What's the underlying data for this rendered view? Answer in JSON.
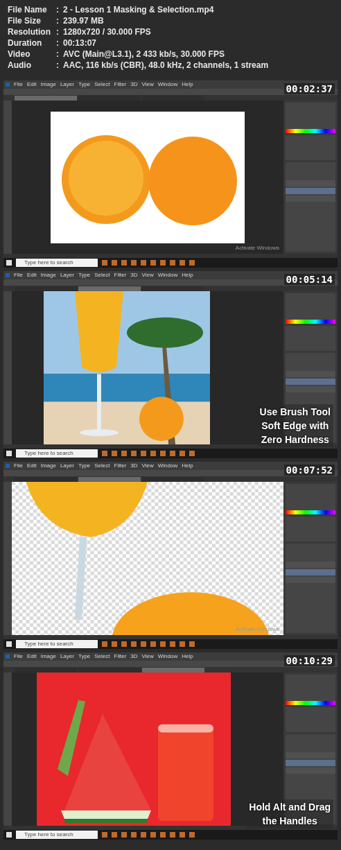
{
  "info": [
    {
      "label": "File Name",
      "separator": ":",
      "value": "2 - Lesson 1 Masking & Selection.mp4"
    },
    {
      "label": "File Size",
      "separator": ":",
      "value": "239.97 MB"
    },
    {
      "label": "Resolution",
      "separator": ":",
      "value": "1280x720 / 30.000 FPS"
    },
    {
      "label": "Duration",
      "separator": ":",
      "value": "00:13:07"
    },
    {
      "label": "Video",
      "separator": ":",
      "value": "AVC (Main@L3.1), 2 433 kb/s, 30.000 FPS"
    },
    {
      "label": "Audio",
      "separator": ":",
      "value": "AAC, 116 kb/s (CBR), 48.0 kHz, 2 channels, 1 stream"
    }
  ],
  "frames": [
    {
      "timestamp": "00:02:37",
      "kind": "oranges",
      "menu": [
        "File",
        "Edit",
        "Image",
        "Layer",
        "Type",
        "Select",
        "Filter",
        "3D",
        "View",
        "Window",
        "Help"
      ],
      "tabs": [
        {
          "selected": true
        },
        {
          "selected": false
        },
        {
          "selected": false
        }
      ],
      "search_placeholder": "Type here to search",
      "activation_notice": "Activate Windows"
    },
    {
      "timestamp": "00:05:14",
      "kind": "beach",
      "menu": [
        "File",
        "Edit",
        "Image",
        "Layer",
        "Type",
        "Select",
        "Filter",
        "3D",
        "View",
        "Window",
        "Help"
      ],
      "tabs": [
        {
          "selected": false
        },
        {
          "selected": true
        },
        {
          "selected": false
        }
      ],
      "search_placeholder": "Type here to search",
      "caption": [
        "Use Brush Tool",
        "Soft Edge with",
        "Zero Hardness"
      ]
    },
    {
      "timestamp": "00:07:52",
      "kind": "glass",
      "menu": [
        "File",
        "Edit",
        "Image",
        "Layer",
        "Type",
        "Select",
        "Filter",
        "3D",
        "View",
        "Window",
        "Help"
      ],
      "tabs": [
        {
          "selected": false
        },
        {
          "selected": true
        },
        {
          "selected": false
        }
      ],
      "search_placeholder": "Type here to search",
      "activation_notice": "Activate Windows"
    },
    {
      "timestamp": "00:10:29",
      "kind": "watermelon",
      "menu": [
        "File",
        "Edit",
        "Image",
        "Layer",
        "Type",
        "Select",
        "Filter",
        "3D",
        "View",
        "Window",
        "Help"
      ],
      "tabs": [
        {
          "selected": false
        },
        {
          "selected": false
        },
        {
          "selected": true
        }
      ],
      "search_placeholder": "Type here to search",
      "caption": [
        "Hold Alt and Drag",
        "the Handles"
      ]
    }
  ]
}
